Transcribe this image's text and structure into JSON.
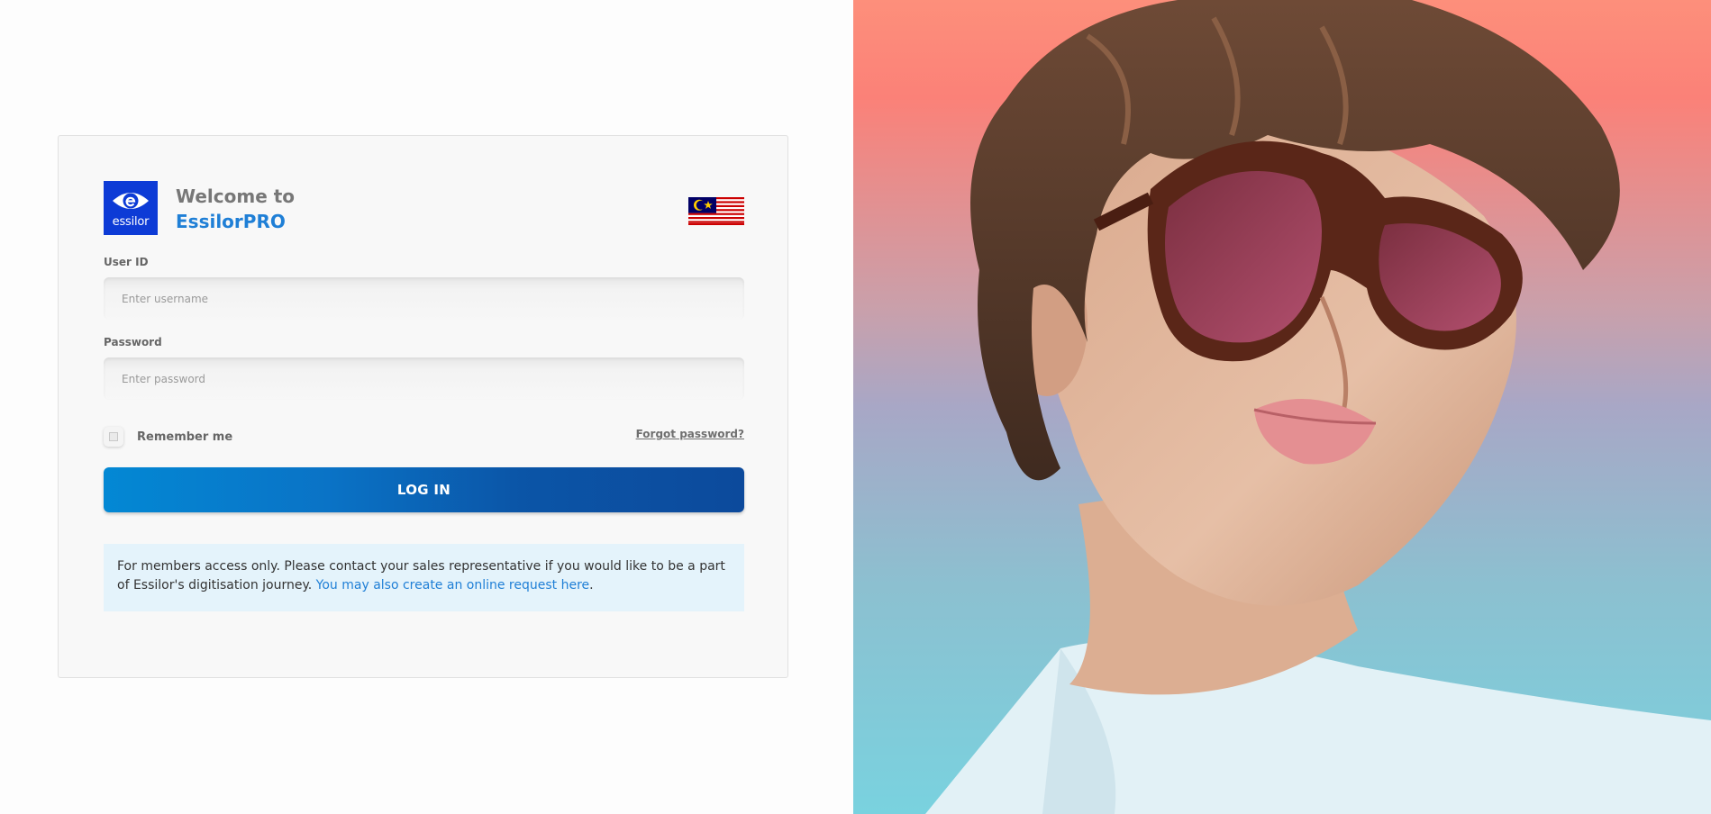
{
  "brand": {
    "logo_text": "essilor",
    "welcome_line1": "Welcome to",
    "welcome_line2": "EssilorPRO",
    "logo_color": "#0d3bd6",
    "accent_color": "#1f7fd6"
  },
  "region": {
    "flag_icon": "malaysia-flag-icon"
  },
  "form": {
    "user_id_label": "User ID",
    "user_id_placeholder": "Enter username",
    "user_id_value": "",
    "password_label": "Password",
    "password_placeholder": "Enter password",
    "password_value": "",
    "remember_label": "Remember me",
    "remember_checked": false,
    "forgot_label": "Forgot password?",
    "login_label": "LOG IN"
  },
  "notice": {
    "text": "For members access only. Please contact your sales representative if you would like to be a part of Essilor's digitisation journey. ",
    "link_text": "You may also create an online request here",
    "suffix": "."
  },
  "hero": {
    "image_icon": "woman-with-sunglasses-photo"
  }
}
